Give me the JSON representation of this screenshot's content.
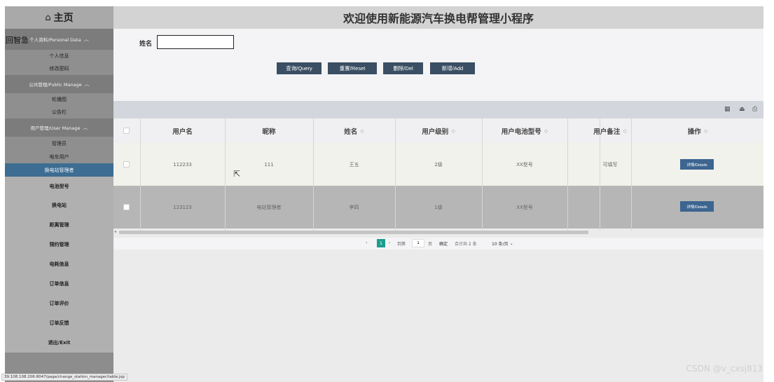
{
  "sidebar": {
    "brand_icon": "home-icon",
    "brand": "主页",
    "overlay_text": "回智急",
    "sections": [
      {
        "label": "个人资料/Personal Data",
        "items": [
          "个人信息",
          "修改密码"
        ]
      },
      {
        "label": "公共管理/Public Manage",
        "items": [
          "轮播图",
          "公告栏"
        ]
      },
      {
        "label": "用户管理/User Manage",
        "items": [
          "管理员",
          "电车用户",
          "换电站管理者"
        ]
      }
    ],
    "active_item": "换电站管理者",
    "menu": [
      "电池型号",
      "换电站",
      "距离管理",
      "预约管理",
      "电耗信息",
      "订单信息",
      "订单评价",
      "订单反馈",
      "退出/Exit"
    ]
  },
  "header": {
    "title": "欢迎使用新能源汽车换电帮管理小程序"
  },
  "search": {
    "name_label": "姓名",
    "name_value": "",
    "buttons": {
      "query": "查询/Query",
      "reset": "重置/Reset",
      "delete": "删除/Del",
      "add": "新增/Add"
    }
  },
  "toolbar": {
    "icons": [
      "columns-icon",
      "export-icon",
      "print-icon"
    ]
  },
  "table": {
    "columns": [
      "用户名",
      "昵称",
      "姓名",
      "用户级别",
      "用户电池型号",
      "用户备注",
      "",
      "操作"
    ],
    "rows": [
      {
        "username": "112233",
        "nickname": "111",
        "name": "王五",
        "level": "2级",
        "battery": "XX型号",
        "remark": "可填写",
        "action": "详情/Details"
      },
      {
        "username": "123123",
        "nickname": "电站管理者",
        "name": "李四",
        "level": "1级",
        "battery": "XX型号",
        "remark": "",
        "action": "详情/Details"
      }
    ]
  },
  "pagination": {
    "current": "1",
    "goto_label": "到第",
    "goto_value": "1",
    "page_unit": "页",
    "confirm": "确定",
    "total": "合计共 2 条",
    "page_size": "10 条/页"
  },
  "statusbar": {
    "url": "39.108.108.206:8047/page/change_station_manager/table.jsp"
  },
  "watermark": "CSDN @v_cxsj813"
}
